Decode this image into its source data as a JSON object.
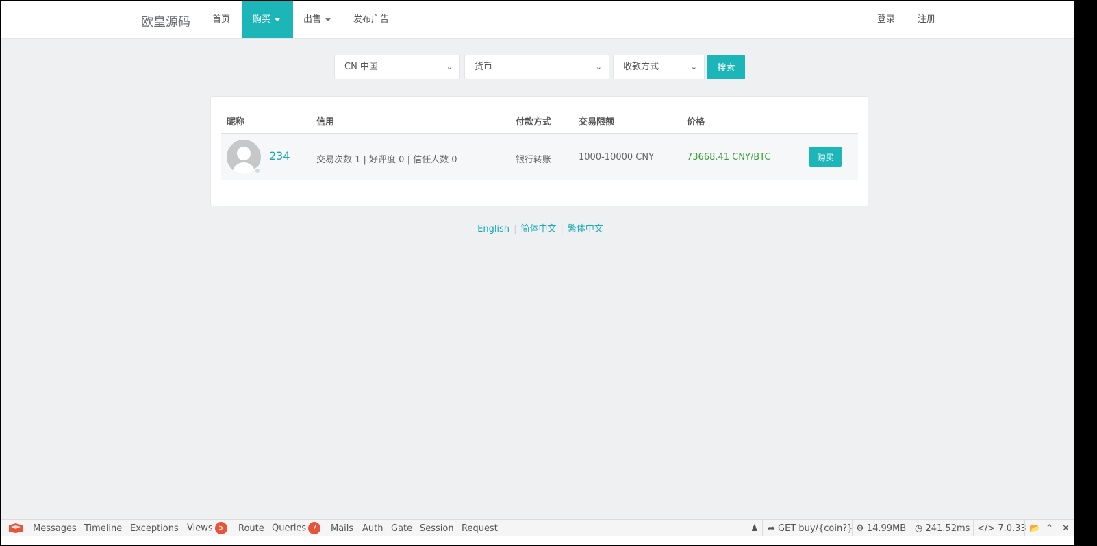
{
  "nav": {
    "brand": "欧皇源码",
    "items": [
      {
        "label": "首页"
      },
      {
        "label": "购买"
      },
      {
        "label": "出售"
      },
      {
        "label": "发布广告"
      }
    ],
    "login": "登录",
    "register": "注册"
  },
  "filters": {
    "country": "CN 中国",
    "currency": "货币",
    "payment": "收款方式",
    "search": "搜索"
  },
  "table": {
    "headers": [
      "昵称",
      "信用",
      "付款方式",
      "交易限额",
      "价格"
    ],
    "rows": [
      {
        "nickname": "234",
        "credit": "交易次数 1 | 好评度 0 | 信任人数 0",
        "payment": "银行转账",
        "limit": "1000-10000 CNY",
        "price": "73668.41 CNY/BTC",
        "action": "购买"
      }
    ]
  },
  "languages": [
    "English",
    "简体中文",
    "繁体中文"
  ],
  "debugbar": {
    "tabs": [
      "Messages",
      "Timeline",
      "Exceptions",
      "Views",
      "Route",
      "Queries",
      "Mails",
      "Auth",
      "Gate",
      "Session",
      "Request"
    ],
    "views_count": "5",
    "queries_count": "7",
    "route": "GET buy/{coin?}",
    "memory": "14.99MB",
    "time": "241.52ms",
    "version": "7.0.33"
  },
  "colors": {
    "accent": "#1cb5b8",
    "price": "#3a9e3a",
    "badge": "#e4553c"
  }
}
